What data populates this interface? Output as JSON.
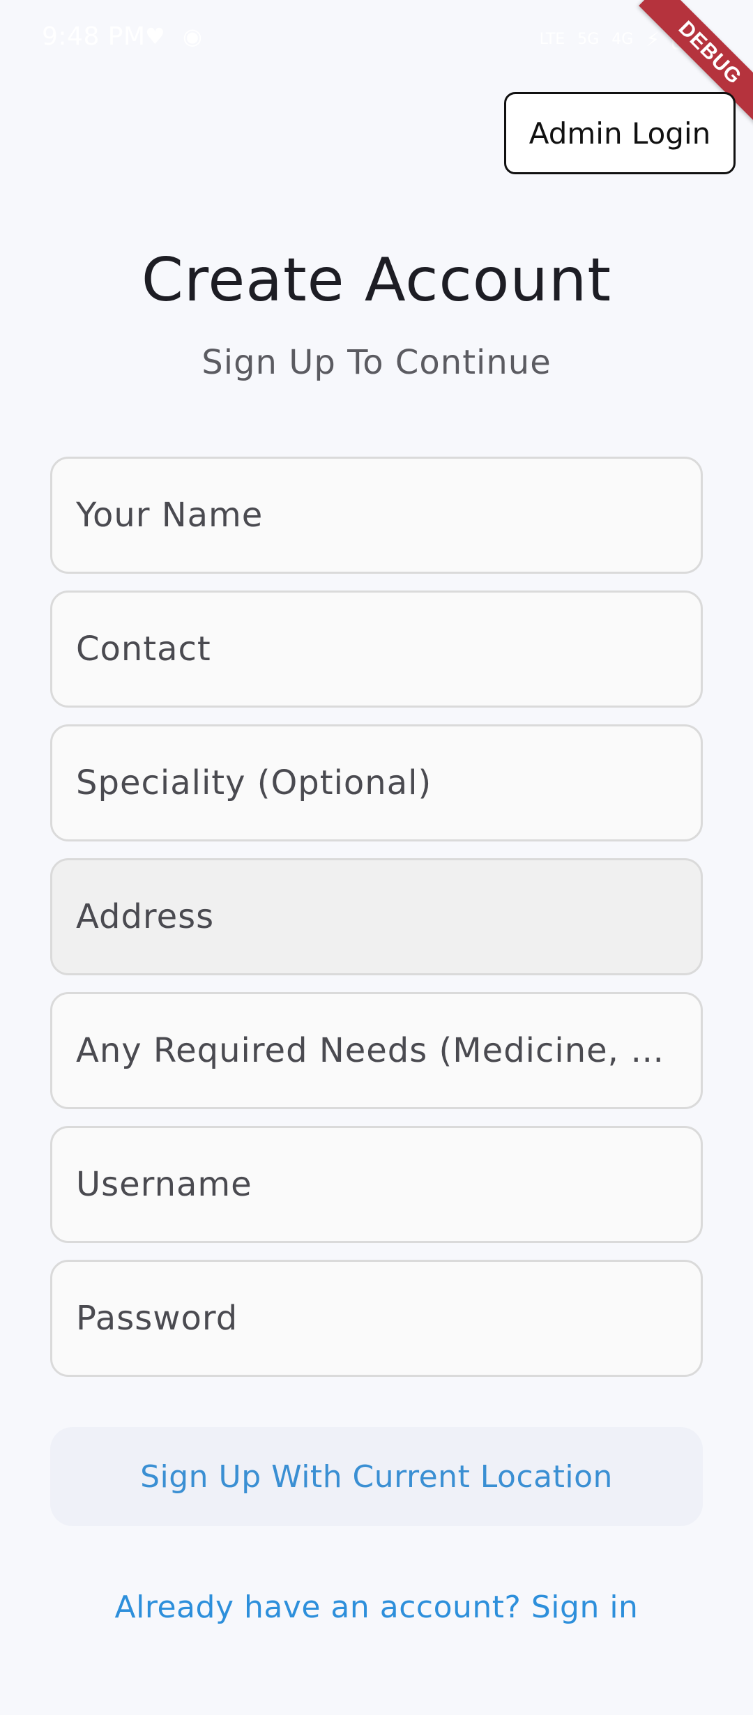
{
  "status_bar": {
    "time": "9:48 PM",
    "network_labels": [
      "LTE",
      "5G",
      "4G"
    ]
  },
  "debug_banner": "DEBUG",
  "header": {
    "admin_login_label": "Admin Login"
  },
  "main": {
    "title": "Create Account",
    "subtitle": "Sign Up To Continue",
    "fields": {
      "name": {
        "placeholder": "Your Name",
        "value": ""
      },
      "contact": {
        "placeholder": "Contact",
        "value": ""
      },
      "speciality": {
        "placeholder": "Speciality (Optional)",
        "value": ""
      },
      "address": {
        "placeholder": "Address",
        "value": ""
      },
      "needs": {
        "placeholder": "Any Required Needs (Medicine, etc.)",
        "value": ""
      },
      "username": {
        "placeholder": "Username",
        "value": ""
      },
      "password": {
        "placeholder": "Password",
        "value": ""
      }
    },
    "location_button_label": "Sign Up With Current Location",
    "signin_link": "Already have an account? Sign in"
  },
  "colors": {
    "background": "#f7f8fc",
    "accent_link": "#2d8fdb",
    "debug_ribbon": "#b5333d"
  }
}
